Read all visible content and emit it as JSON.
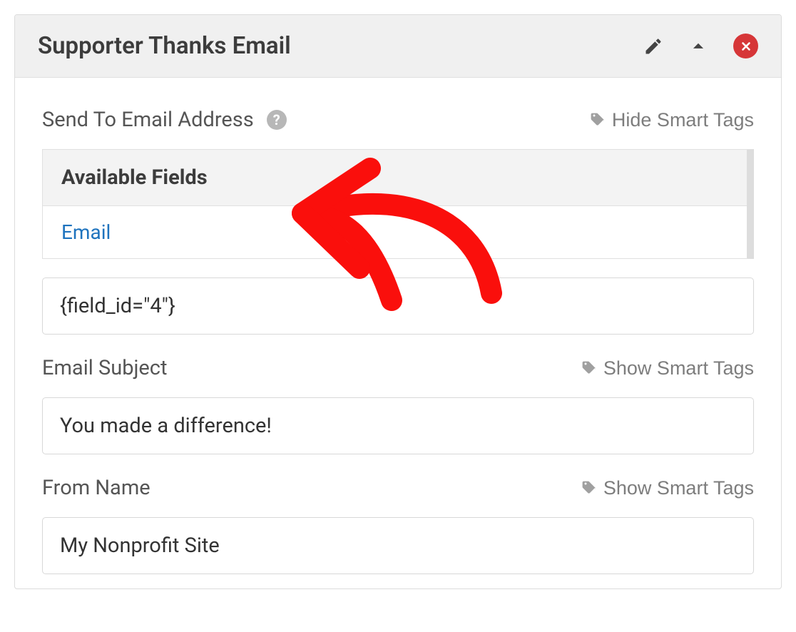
{
  "panel": {
    "title": "Supporter Thanks Email"
  },
  "fields": {
    "send_to": {
      "label": "Send To Email Address",
      "help": "?",
      "smart_tags_toggle": "Hide Smart Tags",
      "available_header": "Available Fields",
      "available_item": "Email",
      "value": "{field_id=\"4\"}"
    },
    "email_subject": {
      "label": "Email Subject",
      "smart_tags_toggle": "Show Smart Tags",
      "value": "You made a difference!"
    },
    "from_name": {
      "label": "From Name",
      "smart_tags_toggle": "Show Smart Tags",
      "value": "My Nonprofit Site"
    }
  }
}
